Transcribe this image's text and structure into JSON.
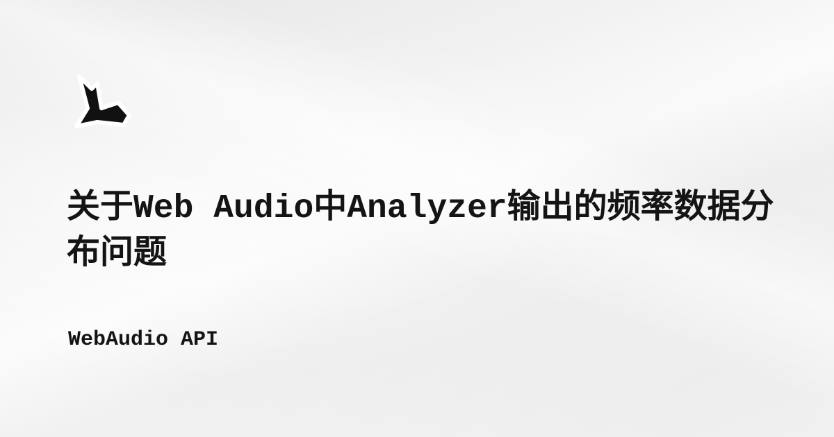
{
  "card": {
    "logo_icon": "swallow-tail-logo-icon",
    "title": "关于Web Audio中Analyzer输出的频率数据分布问题",
    "tag": "WebAudio API"
  },
  "colors": {
    "text": "#141414",
    "logo_fill": "#111111",
    "logo_outline": "#ffffff",
    "background": "#efefef"
  }
}
